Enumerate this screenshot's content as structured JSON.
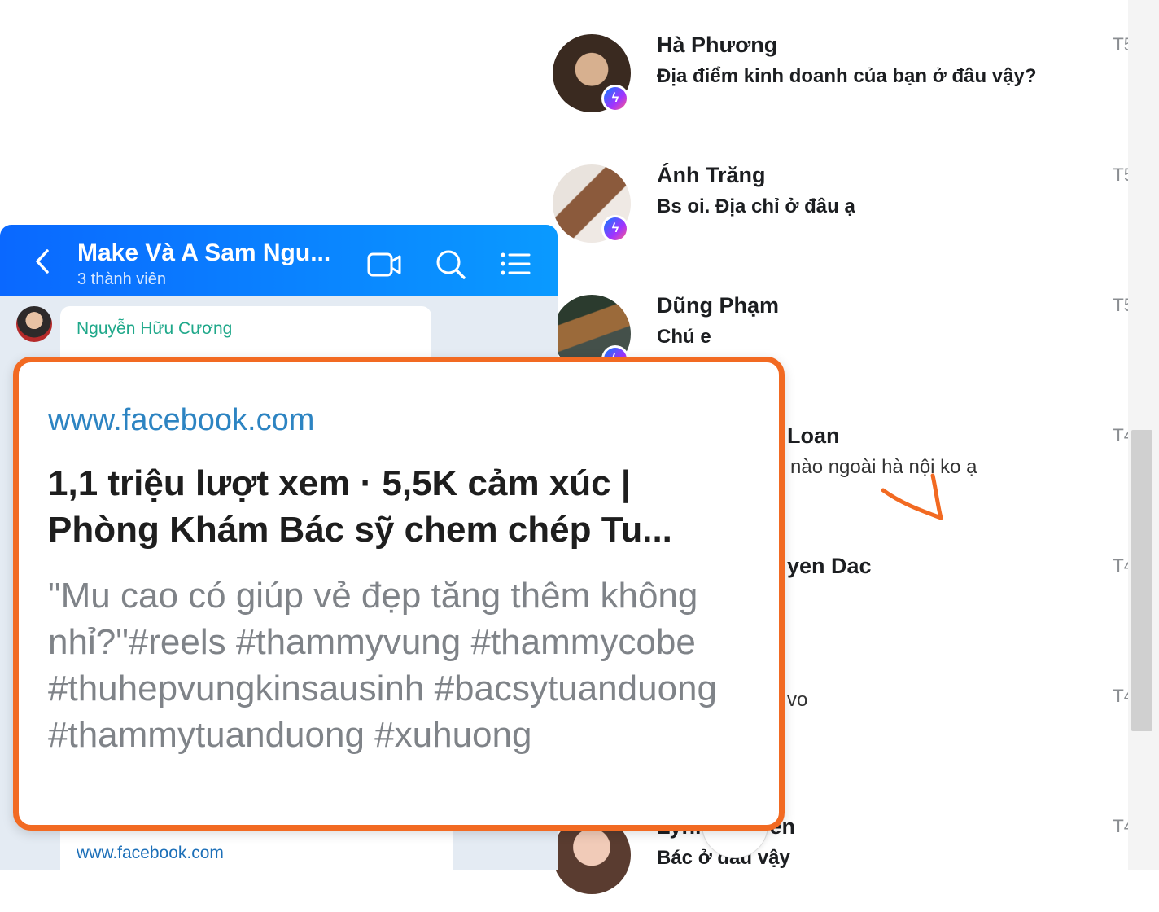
{
  "inbox": {
    "conversations": [
      {
        "name": "Hà Phương",
        "message": "Địa điểm kinh doanh của bạn ở đâu vậy?",
        "day": "T5",
        "badge": "messenger"
      },
      {
        "name": "Ánh Trăng",
        "message": "Bs oi. Địa chỉ ở đâu ạ",
        "day": "T5",
        "badge": "messenger"
      },
      {
        "name": "Dũng Phạm",
        "message": "Chú e",
        "day": "T5",
        "badge": "messenger"
      },
      {
        "name": "Loan",
        "message": "nào ngoài hà nội ko ạ",
        "day": "T4"
      },
      {
        "name": "yen Dac",
        "message": "",
        "day": "T4"
      },
      {
        "name": "",
        "message": "vo",
        "day": "T4"
      },
      {
        "name": "Lynn Nguyen",
        "message": "Bác ở đâu vậy",
        "day": "T4"
      }
    ]
  },
  "zalo": {
    "title": "Make Và A Sam Ngu...",
    "subtitle": "3 thành viên",
    "sender": "Nguyễn Hữu Cương",
    "second_link_domain": "www.facebook.com",
    "icons": [
      "back-icon",
      "video-call-icon",
      "search-icon",
      "menu-list-icon"
    ]
  },
  "preview": {
    "domain": "www.facebook.com",
    "title": "1,1 triệu lượt xem · 5,5K cảm xúc | Phòng Khám Bác sỹ chem chép Tu...",
    "description": "\"Mu cao có giúp vẻ đẹp tăng thêm không nhỉ?\"#reels #thammyvung #thammycobe #thuhepvungkinsausinh #bacsytuanduong #thammytuanduong #xuhuong"
  },
  "colors": {
    "accent_outline": "#f26a22",
    "zalo_blue": "#0a68ff",
    "link_blue": "#2d84c2"
  }
}
